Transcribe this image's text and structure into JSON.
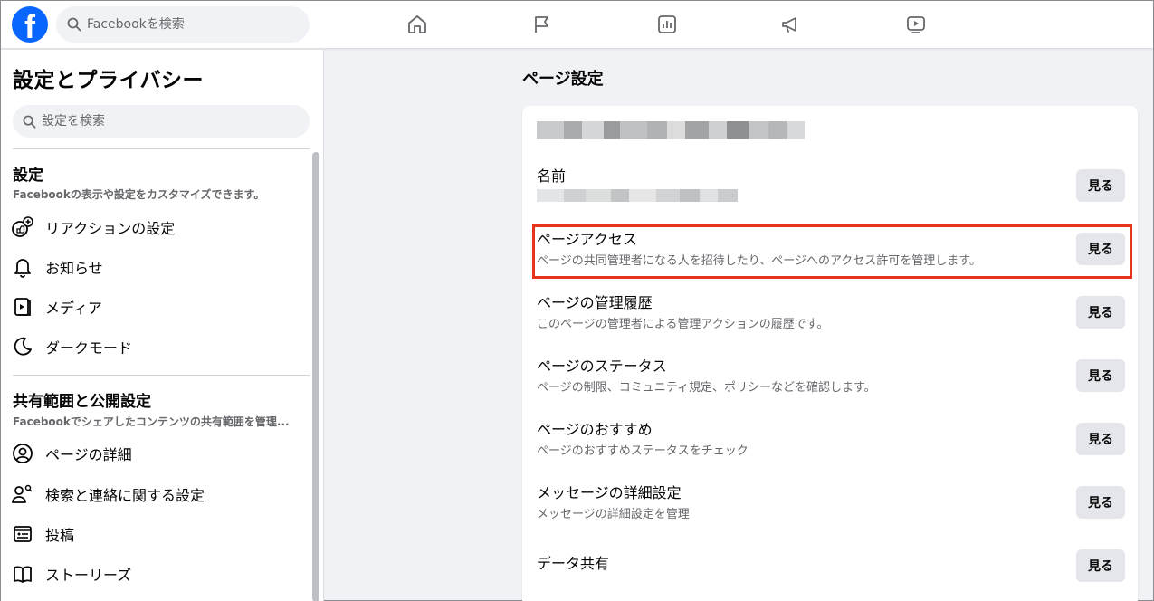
{
  "header": {
    "logo_letter": "f",
    "search_placeholder": "Facebookを検索",
    "nav_icons": [
      "home-icon",
      "flag-icon",
      "insights-icon",
      "megaphone-icon",
      "video-icon"
    ]
  },
  "sidebar": {
    "title": "設定とプライバシー",
    "search_placeholder": "設定を検索",
    "section1": {
      "title": "設定",
      "subtitle": "Facebookの表示や設定をカスタマイズできます。",
      "items": [
        {
          "label": "リアクションの設定",
          "icon": "reaction-icon"
        },
        {
          "label": "お知らせ",
          "icon": "bell-icon"
        },
        {
          "label": "メディア",
          "icon": "media-icon"
        },
        {
          "label": "ダークモード",
          "icon": "moon-icon"
        }
      ]
    },
    "section2": {
      "title": "共有範囲と公開設定",
      "subtitle": "Facebookでシェアしたコンテンツの共有範囲を管理...",
      "items": [
        {
          "label": "ページの詳細",
          "icon": "user-circle-icon"
        },
        {
          "label": "検索と連絡に関する設定",
          "icon": "user-search-icon"
        },
        {
          "label": "投稿",
          "icon": "post-icon"
        },
        {
          "label": "ストーリーズ",
          "icon": "book-icon"
        }
      ]
    }
  },
  "main": {
    "title": "ページ設定",
    "view_label": "見る",
    "settings": [
      {
        "title": "名前",
        "subtitle": ""
      },
      {
        "title": "ページアクセス",
        "subtitle": "ページの共同管理者になる人を招待したり、ページへのアクセス許可を管理します。"
      },
      {
        "title": "ページの管理履歴",
        "subtitle": "このページの管理者による管理アクションの履歴です。"
      },
      {
        "title": "ページのステータス",
        "subtitle": "ページの制限、コミュニティ規定、ポリシーなどを確認します。"
      },
      {
        "title": "ページのおすすめ",
        "subtitle": "ページのおすすめステータスをチェック"
      },
      {
        "title": "メッセージの詳細設定",
        "subtitle": "メッセージの詳細設定を管理"
      },
      {
        "title": "データ共有",
        "subtitle": ""
      }
    ]
  },
  "colors": {
    "brand": "#0866ff",
    "highlight": "#e8321c"
  }
}
